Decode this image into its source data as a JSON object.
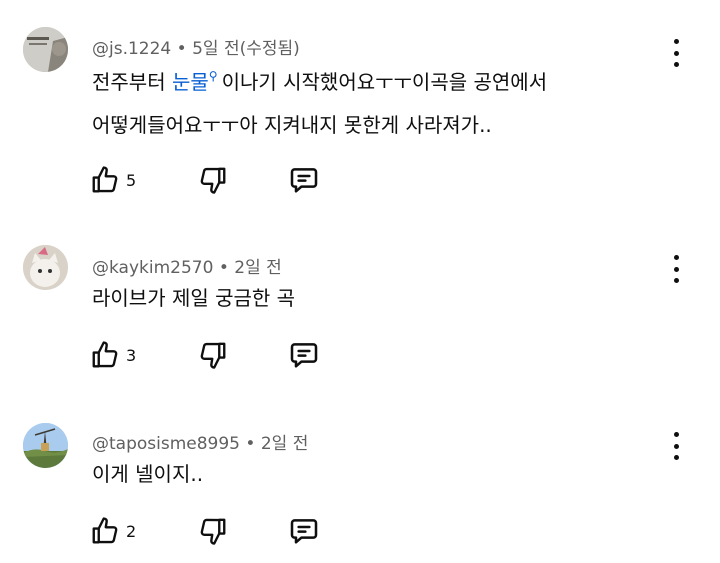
{
  "comments": [
    {
      "handle": "@js.1224",
      "sep": "•",
      "time": "5일 전(수정됨)",
      "text_line1_a": "전주부터 ",
      "text_line1_link": "눈물",
      "text_line1_b": "이나기 시작했어요ㅜㅜ이곡을 공연에서",
      "text_line2": "어떻게들어요ㅜㅜ아 지켜내지 못한게 사라져가..",
      "likes": "5",
      "avatar_colors": [
        "#c9c7c2",
        "#7d7a74"
      ]
    },
    {
      "handle": "@kaykim2570",
      "sep": "•",
      "time": "2일 전",
      "text_line1": "라이브가 제일 궁금한 곡",
      "likes": "3",
      "avatar_colors": [
        "#e8e2da",
        "#b8aea0"
      ]
    },
    {
      "handle": "@taposisme8995",
      "sep": "•",
      "time": "2일 전",
      "text_line1": "이게 넬이지..",
      "likes": "2",
      "avatar_colors": [
        "#9cc1e8",
        "#4f6b35"
      ]
    }
  ],
  "icons": {
    "like": "thumbs-up-icon",
    "dislike": "thumbs-down-icon",
    "reply": "reply-comment-icon",
    "more": "more-vertical-icon",
    "search_hint": "search-icon"
  }
}
